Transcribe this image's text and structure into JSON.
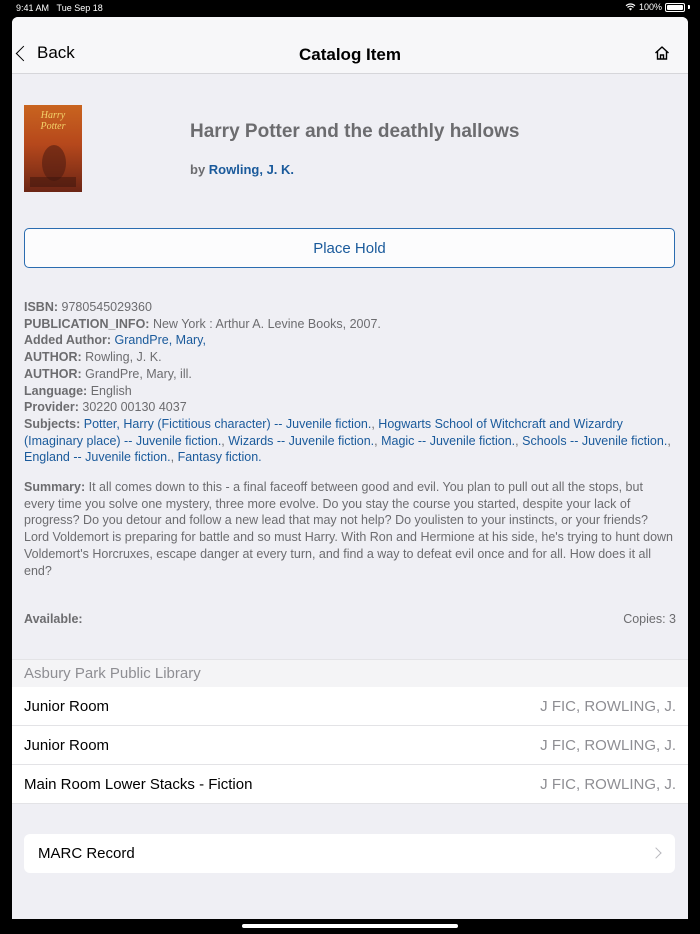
{
  "status_bar": {
    "time": "9:41 AM",
    "date": "Tue Sep 18",
    "battery": "100%"
  },
  "nav": {
    "back_label": "Back",
    "title": "Catalog Item"
  },
  "item": {
    "title": "Harry Potter and the deathly hallows",
    "by_prefix": "by",
    "author": "Rowling, J. K.",
    "cover_text": [
      "Harry",
      "Potter"
    ],
    "hold_label": "Place Hold"
  },
  "metadata": {
    "isbn_key": "ISBN:",
    "isbn": "9780545029360",
    "pub_key": "PUBLICATION_INFO:",
    "pub": "New York : Arthur A. Levine Books, 2007.",
    "added_key": "Added Author:",
    "added": "GrandPre, Mary,",
    "author1_key": "AUTHOR:",
    "author1": "Rowling, J. K.",
    "author2_key": "AUTHOR:",
    "author2": "GrandPre, Mary, ill.",
    "lang_key": "Language:",
    "lang": "English",
    "provider_key": "Provider:",
    "provider": "30220 00130 4037",
    "subjects_key": "Subjects:",
    "subjects": [
      "Potter, Harry (Fictitious character) -- Juvenile fiction.",
      "Hogwarts School of Witchcraft and Wizardry (Imaginary place) -- Juvenile fiction.",
      "Wizards -- Juvenile fiction.",
      "Magic -- Juvenile fiction.",
      "Schools -- Juvenile fiction.",
      "England -- Juvenile fiction.",
      "Fantasy fiction."
    ],
    "sep": ", "
  },
  "summary": {
    "key": "Summary:",
    "text": "It all comes down to this - a final faceoff between good and evil. You plan to pull out all the stops, but every time you solve one mystery, three more evolve. Do you stay the course you started, despite your lack of progress? Do you detour and follow a new lead that may not help? Do youlisten to your instincts, or your friends? Lord Voldemort is preparing for battle and so must Harry. With Ron and Hermione at his side, he's trying to hunt down Voldemort's Horcruxes, escape danger at every turn, and find a way to defeat evil once and for all. How does it all end?"
  },
  "availability": {
    "label": "Available:",
    "copies": "Copies: 3"
  },
  "library": {
    "name": "Asbury Park Public Library",
    "rows": [
      {
        "location": "Junior Room",
        "call_number": "J FIC, ROWLING, J."
      },
      {
        "location": "Junior Room",
        "call_number": "J FIC, ROWLING, J."
      },
      {
        "location": "Main Room Lower Stacks - Fiction",
        "call_number": "J FIC, ROWLING, J."
      }
    ]
  },
  "marc": {
    "label": "MARC Record"
  },
  "colors": {
    "link": "#1a5a9b",
    "secondary_text": "#6c6c6f",
    "background": "#efeff4"
  }
}
